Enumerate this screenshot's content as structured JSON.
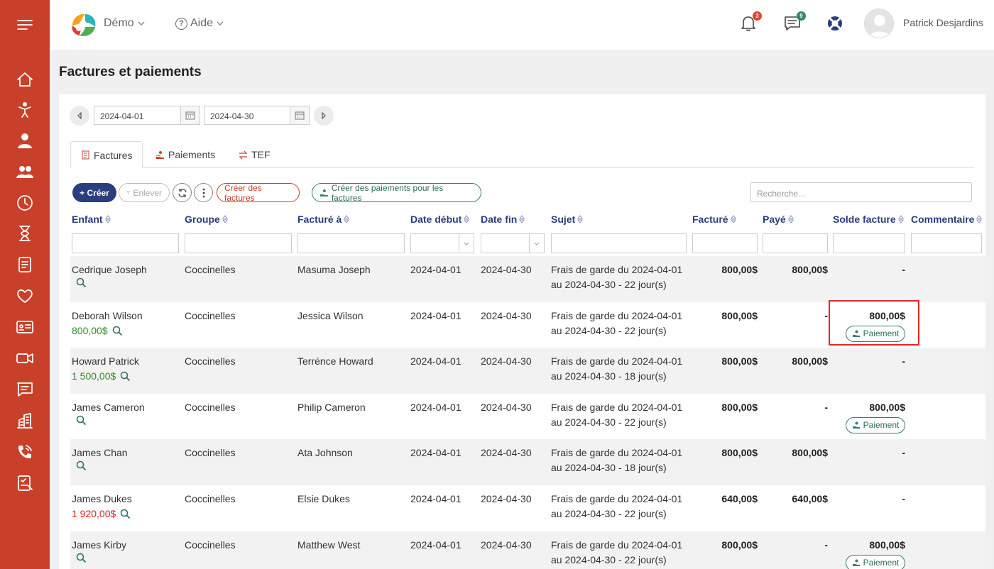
{
  "header": {
    "org_label": "Démo",
    "help_label": "Aide",
    "notif_count": "3",
    "msg_count": "9",
    "user_name": "Patrick Desjardins"
  },
  "page": {
    "title": "Factures et paiements"
  },
  "dates": {
    "start": "2024-04-01",
    "end": "2024-04-30"
  },
  "tabs": [
    {
      "label": "Factures"
    },
    {
      "label": "Paiements"
    },
    {
      "label": "TEF"
    }
  ],
  "toolbar": {
    "create_label": "+ Créer",
    "remove_label": "Enlever",
    "create_invoices_label": "Créer des factures",
    "create_payments_label": "Créer des paiements pour les factures",
    "search_placeholder": "Recherche..."
  },
  "columns": [
    "Enfant",
    "Groupe",
    "Facturé à",
    "Date début",
    "Date fin",
    "Sujet",
    "Facturé",
    "Payé",
    "Solde facture",
    "Commentaire"
  ],
  "pay_label": "Paiement",
  "rows": [
    {
      "child": "Cedrique Joseph",
      "child_amount": "",
      "group": "Coccinelles",
      "billed_to": "Masuma Joseph",
      "start": "2024-04-01",
      "end": "2024-04-30",
      "subject1": "Frais de garde du 2024-04-01",
      "subject2": "au 2024-04-30 - 22 jour(s)",
      "billed": "800,00$",
      "paid": "800,00$",
      "balance": "-"
    },
    {
      "child": "Deborah Wilson",
      "child_amount": "800,00$",
      "group": "Coccinelles",
      "billed_to": "Jessica Wilson",
      "start": "2024-04-01",
      "end": "2024-04-30",
      "subject1": "Frais de garde du 2024-04-01",
      "subject2": "au 2024-04-30 - 22 jour(s)",
      "billed": "800,00$",
      "paid": "-",
      "balance": "800,00$"
    },
    {
      "child": "Howard Patrick",
      "child_amount": "1 500,00$",
      "group": "Coccinelles",
      "billed_to": "Terrénce Howard",
      "start": "2024-04-01",
      "end": "2024-04-30",
      "subject1": "Frais de garde du 2024-04-01",
      "subject2": "au 2024-04-30 - 18 jour(s)",
      "billed": "800,00$",
      "paid": "800,00$",
      "balance": "-"
    },
    {
      "child": "James Cameron",
      "child_amount": "",
      "group": "Coccinelles",
      "billed_to": "Philip Cameron",
      "start": "2024-04-01",
      "end": "2024-04-30",
      "subject1": "Frais de garde du 2024-04-01",
      "subject2": "au 2024-04-30 - 22 jour(s)",
      "billed": "800,00$",
      "paid": "-",
      "balance": "800,00$"
    },
    {
      "child": "James Chan",
      "child_amount": "",
      "group": "Coccinelles",
      "billed_to": "Ata Johnson",
      "start": "2024-04-01",
      "end": "2024-04-30",
      "subject1": "Frais de garde du 2024-04-01",
      "subject2": "au 2024-04-30 - 18 jour(s)",
      "billed": "800,00$",
      "paid": "800,00$",
      "balance": "-"
    },
    {
      "child": "James Dukes",
      "child_amount": "1 920,00$",
      "group": "Coccinelles",
      "billed_to": "Elsie Dukes",
      "start": "2024-04-01",
      "end": "2024-04-30",
      "subject1": "Frais de garde du 2024-04-01",
      "subject2": "au 2024-04-30 - 22 jour(s)",
      "billed": "640,00$",
      "paid": "640,00$",
      "balance": "-"
    },
    {
      "child": "James Kirby",
      "child_amount": "",
      "group": "Coccinelles",
      "billed_to": "Matthew West",
      "start": "2024-04-01",
      "end": "2024-04-30",
      "subject1": "Frais de garde du 2024-04-01",
      "subject2": "au 2024-04-30 - 22 jour(s)",
      "billed": "800,00$",
      "paid": "-",
      "balance": "800,00$"
    }
  ]
}
